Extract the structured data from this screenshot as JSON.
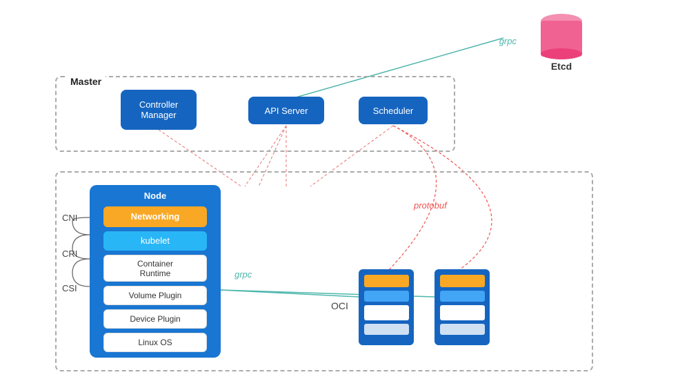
{
  "etcd": {
    "label": "Etcd"
  },
  "master": {
    "label": "Master",
    "controller_manager": "Controller\nManager",
    "api_server": "API Server",
    "scheduler": "Scheduler"
  },
  "node": {
    "label": "Node",
    "networking": "Networking",
    "kubelet": "kubelet",
    "container_runtime": "Container\nRuntime",
    "volume_plugin": "Volume Plugin",
    "device_plugin": "Device Plugin",
    "linux_os": "Linux OS"
  },
  "labels": {
    "grpc_top": "grpc",
    "grpc_node": "grpc",
    "protobuf": "protobuf",
    "oci": "OCI",
    "cni": "CNI",
    "cri": "CRI",
    "csi": "CSI"
  }
}
